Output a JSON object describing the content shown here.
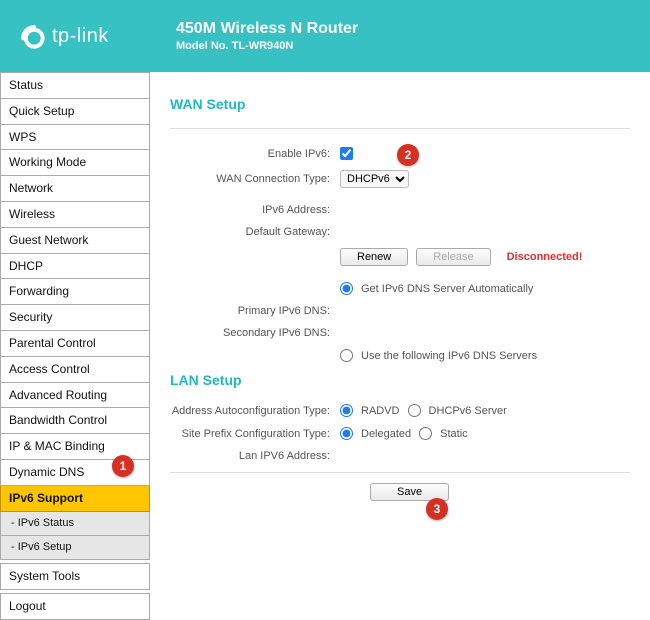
{
  "brand": {
    "name": "tp-link"
  },
  "header": {
    "title": "450M Wireless N Router",
    "model": "Model No. TL-WR940N"
  },
  "sidebar": {
    "items": [
      {
        "label": "Status"
      },
      {
        "label": "Quick Setup"
      },
      {
        "label": "WPS"
      },
      {
        "label": "Working Mode"
      },
      {
        "label": "Network"
      },
      {
        "label": "Wireless"
      },
      {
        "label": "Guest Network"
      },
      {
        "label": "DHCP"
      },
      {
        "label": "Forwarding"
      },
      {
        "label": "Security"
      },
      {
        "label": "Parental Control"
      },
      {
        "label": "Access Control"
      },
      {
        "label": "Advanced Routing"
      },
      {
        "label": "Bandwidth Control"
      },
      {
        "label": "IP & MAC Binding"
      },
      {
        "label": "Dynamic DNS"
      },
      {
        "label": "IPv6 Support",
        "active": true
      },
      {
        "label": "- IPv6 Status",
        "sub": true
      },
      {
        "label": "- IPv6 Setup",
        "sub": true
      },
      {
        "label": "System Tools"
      },
      {
        "label": "Logout"
      }
    ]
  },
  "wan": {
    "section_title": "WAN Setup",
    "enable_label": "Enable IPv6:",
    "enabled": true,
    "conntype_label": "WAN Connection Type:",
    "conntype_value": "DHCPv6",
    "ipv6addr_label": "IPv6 Address:",
    "gateway_label": "Default Gateway:",
    "renew_label": "Renew",
    "release_label": "Release",
    "status": "Disconnected!",
    "dns_auto_label": "Get IPv6 DNS Server Automatically",
    "primary_dns_label": "Primary IPv6 DNS:",
    "secondary_dns_label": "Secondary IPv6 DNS:",
    "dns_manual_label": "Use the following IPv6 DNS Servers"
  },
  "lan": {
    "section_title": "LAN Setup",
    "autoconf_label": "Address Autoconfiguration Type:",
    "radvd_label": "RADVD",
    "dhcpv6srv_label": "DHCPv6 Server",
    "prefix_label": "Site Prefix Configuration Type:",
    "delegated_label": "Delegated",
    "static_label": "Static",
    "lanipv6_label": "Lan IPV6 Address:"
  },
  "actions": {
    "save_label": "Save"
  },
  "annotations": {
    "a1": "1",
    "a2": "2",
    "a3": "3"
  }
}
